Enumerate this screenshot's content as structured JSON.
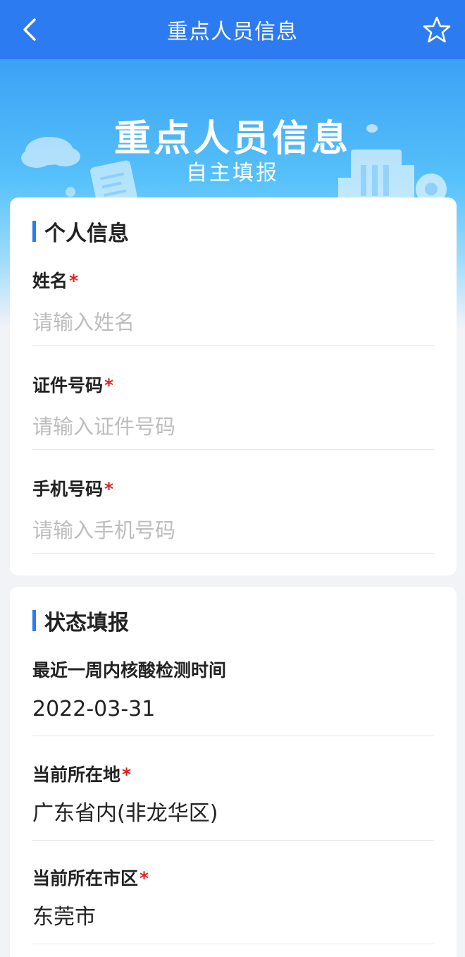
{
  "nav": {
    "title": "重点人员信息"
  },
  "banner": {
    "title": "重点人员信息",
    "subtitle": "自主填报"
  },
  "personal": {
    "section_title": "个人信息",
    "fields": [
      {
        "label": "姓名",
        "required": "*",
        "placeholder": "请输入姓名"
      },
      {
        "label": "证件号码",
        "required": "*",
        "placeholder": "请输入证件号码"
      },
      {
        "label": "手机号码",
        "required": "*",
        "placeholder": "请输入手机号码"
      }
    ]
  },
  "status": {
    "section_title": "状态填报",
    "fields": [
      {
        "label": "最近一周内核酸检测时间",
        "value": "2022-03-31"
      },
      {
        "label": "当前所在地",
        "required": "*",
        "value": "广东省内(非龙华区)"
      },
      {
        "label": "当前所在市区",
        "required": "*",
        "value": "东莞市"
      }
    ]
  },
  "colors": {
    "primary": "#2d7bf0",
    "required": "#e02020",
    "placeholder": "#bdbdbd"
  },
  "icons": {
    "back": "chevron-left-icon",
    "favorite": "star-outline-icon"
  }
}
